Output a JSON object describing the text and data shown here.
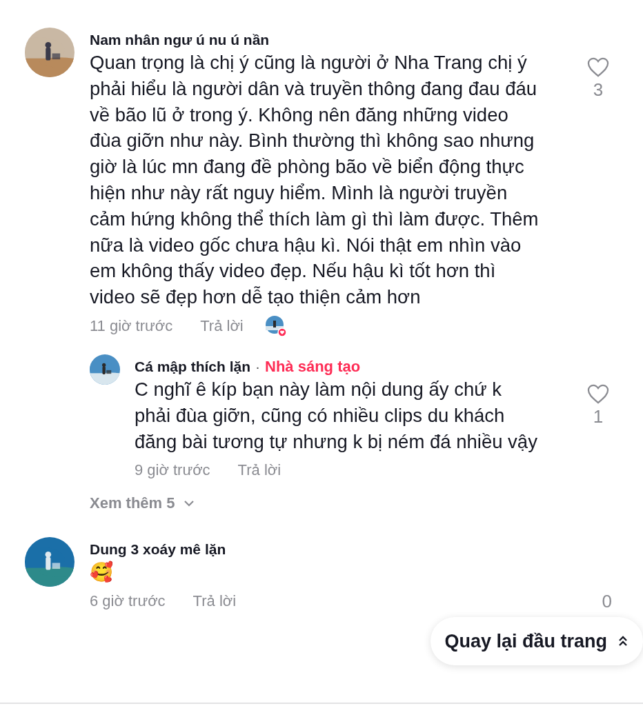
{
  "comments": [
    {
      "author": "Nam nhân ngư ú nu ú nần",
      "text": "Quan trọng là chị ý cũng là người ở Nha Trang chị ý phải hiểu là người dân và truyền thông đang đau đáu về bão lũ ở trong ý. Không nên đăng những video đùa giỡn như này. Bình thường thì không sao nhưng giờ là lúc mn đang đề phòng bão về biển động thực hiện như này rất nguy hiểm. Mình là người truyền cảm hứng không thể thích làm gì thì làm được. Thêm nữa là video gốc chưa hậu kì. Nói thật em nhìn vào em không thấy video đẹp. Nếu hậu kì tốt hơn thì video sẽ đẹp hơn dễ tạo thiện cảm hơn",
      "time": "11 giờ trước",
      "reply": "Trả lời",
      "likes": "3",
      "liked_by_creator": true,
      "replies": [
        {
          "author": "Cá mập thích lặn",
          "separator": "·",
          "badge": "Nhà sáng tạo",
          "text": "C nghĩ ê kíp bạn này làm nội dung ấy chứ k phải đùa giỡn, cũng có nhiều clips du khách đăng bài tương tự nhưng k bị ném đá nhiều vậy",
          "time": "9 giờ trước",
          "reply": "Trả lời",
          "likes": "1"
        }
      ],
      "more_replies": "Xem thêm 5"
    },
    {
      "author": "Dung 3 xoáy mê lặn",
      "text": "🥰",
      "time": "6 giờ trước",
      "reply": "Trả lời",
      "likes": "0",
      "liked_by_creator": false
    }
  ],
  "back_to_top": "Quay lại đầu trang"
}
